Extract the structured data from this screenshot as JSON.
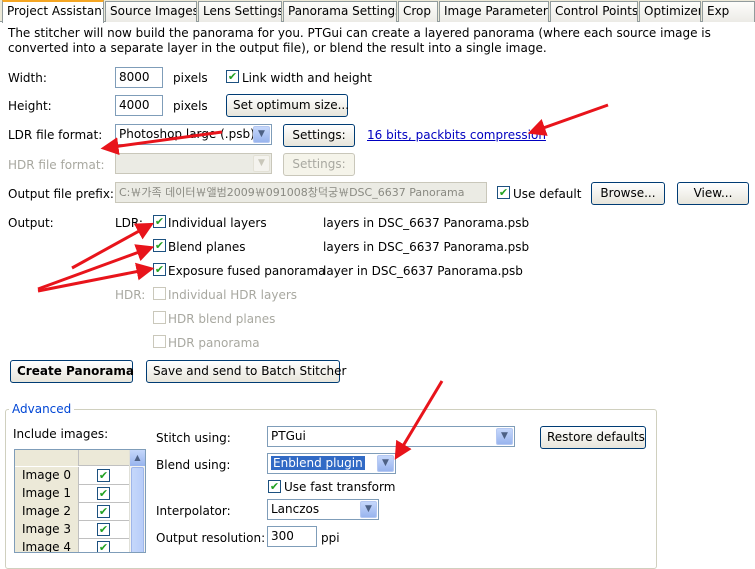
{
  "tabs": [
    {
      "label": "Project Assistant"
    },
    {
      "label": "Source Images"
    },
    {
      "label": "Lens Settings"
    },
    {
      "label": "Panorama Settings"
    },
    {
      "label": "Crop"
    },
    {
      "label": "Image Parameters"
    },
    {
      "label": "Control Points"
    },
    {
      "label": "Optimizer"
    },
    {
      "label": "Exp"
    }
  ],
  "description": "The stitcher will now build the panorama for you. PTGui can create a layered panorama (where each source image is converted into a separate layer in the output file), or blend the result into a single image.",
  "width": {
    "label": "Width:",
    "value": "8000",
    "unit": "pixels"
  },
  "height": {
    "label": "Height:",
    "value": "4000",
    "unit": "pixels"
  },
  "link_wh_label": "Link width and height",
  "optimum_button": "Set optimum size...",
  "ldr_format": {
    "label": "LDR file format:",
    "value": "Photoshop large (.psb)",
    "settings_button": "Settings:",
    "settings_link": "16 bits, packbits compression"
  },
  "hdr_format": {
    "label": "HDR file format:",
    "value": "",
    "settings_button": "Settings:"
  },
  "output_prefix": {
    "label": "Output file prefix:",
    "value": "C:￦가족 데이터￦앨범2009￦091008창덕궁￦DSC_6637 Panorama",
    "use_default_label": "Use default",
    "browse_button": "Browse...",
    "view_button": "View..."
  },
  "output": {
    "label": "Output:",
    "ldr_label": "LDR:",
    "hdr_label": "HDR:",
    "ldr_items": [
      {
        "label": "Individual layers",
        "note": "layers in DSC_6637 Panorama.psb"
      },
      {
        "label": "Blend planes",
        "note": "layers in DSC_6637 Panorama.psb"
      },
      {
        "label": "Exposure fused panorama",
        "note": "layer in DSC_6637 Panorama.psb"
      }
    ],
    "hdr_items": [
      {
        "label": "Individual HDR layers"
      },
      {
        "label": "HDR blend planes"
      },
      {
        "label": "HDR panorama"
      }
    ]
  },
  "create_button": "Create Panorama",
  "batch_button": "Save and send to Batch Stitcher",
  "advanced": {
    "title": "Advanced",
    "include_label": "Include images:",
    "images": [
      "Image 0",
      "Image 1",
      "Image 2",
      "Image 3",
      "Image 4"
    ],
    "stitch_label": "Stitch using:",
    "stitch_value": "PTGui",
    "restore_button": "Restore defaults",
    "blend_label": "Blend using:",
    "blend_value": "Enblend plugin",
    "fast_transform_label": "Use fast transform",
    "interpolator_label": "Interpolator:",
    "interpolator_value": "Lanczos",
    "resolution_label": "Output resolution:",
    "resolution_value": "300",
    "resolution_unit": "ppi"
  },
  "colors": {
    "arrow": "#e8141b",
    "accent_link": "#0000c0",
    "group_title": "#0046d5"
  }
}
